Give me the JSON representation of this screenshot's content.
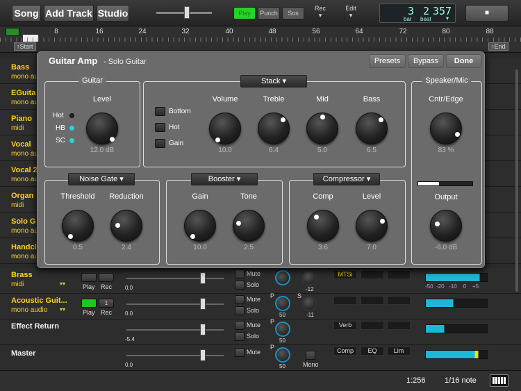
{
  "toolbar": {
    "song": "Song",
    "add_track": "Add Track",
    "studio": "Studio",
    "play": "Play",
    "punch": "Punch",
    "sos": "Sos",
    "rec": "Rec",
    "edit": "Edit",
    "counter": {
      "bar": "3",
      "beat": "2",
      "tick": "357",
      "bar_label": "bar",
      "beat_label": "beat"
    }
  },
  "ruler": {
    "numbers": [
      "8",
      "16",
      "24",
      "32",
      "40",
      "48",
      "56",
      "64",
      "72",
      "80",
      "88"
    ],
    "start": "Start",
    "end": "End"
  },
  "tracks": [
    {
      "name": "Bass",
      "type": "mono au"
    },
    {
      "name": "EGuita",
      "type": "mono au"
    },
    {
      "name": "Piano",
      "type": "midi"
    },
    {
      "name": "Vocal",
      "type": "mono au"
    },
    {
      "name": "Vocal 2",
      "type": "mono au"
    },
    {
      "name": "Organ",
      "type": "midi"
    },
    {
      "name": "Solo G",
      "type": "mono au"
    },
    {
      "name": "Handcl",
      "type": "mono au"
    },
    {
      "name": "Brass",
      "type": "midi"
    },
    {
      "name": "Acoustic Guit...",
      "type": "mono audio"
    },
    {
      "name": "Effect Return",
      "type": ""
    },
    {
      "name": "Master",
      "type": ""
    }
  ],
  "mixer": {
    "play": "Play",
    "rec": "Rec",
    "mute": "Mute",
    "solo": "Solo",
    "mono": "Mono",
    "pan": "P",
    "send": "S",
    "vol_zero": "0.0",
    "vol_fx": "-5.4",
    "pan_val": "50",
    "send_brass": "-12",
    "send_acoustic": "-11",
    "prog": "1",
    "fx_brass": "MTSi",
    "fx_return": "Verb",
    "fx_master": [
      "Comp",
      "EQ",
      "Lim"
    ],
    "meter_scale": [
      "-50",
      "-20",
      "-10",
      "0",
      "+5"
    ]
  },
  "amp": {
    "title": "Guitar Amp",
    "subtitle": "- Solo Guitar",
    "presets": "Presets",
    "bypass": "Bypass",
    "done": "Done",
    "guitar": {
      "title": "Guitar",
      "level_label": "Level",
      "level_value": "12.0 dB",
      "options": [
        "Hot",
        "HB",
        "SC"
      ],
      "active": [
        false,
        true,
        true
      ]
    },
    "stack": {
      "title": "Stack",
      "checks": [
        "Bottom",
        "Hot",
        "Gain"
      ],
      "knobs": [
        {
          "label": "Volume",
          "value": "10.0"
        },
        {
          "label": "Treble",
          "value": "6.4"
        },
        {
          "label": "Mid",
          "value": "5.0"
        },
        {
          "label": "Bass",
          "value": "6.5"
        }
      ]
    },
    "speaker": {
      "title": "Speaker/Mic",
      "cntr_label": "Cntr/Edge",
      "cntr_value": "83 %",
      "output_label": "Output",
      "output_value": "-6.0 dB",
      "level_fraction": 0.38
    },
    "gate": {
      "title": "Noise Gate",
      "knobs": [
        {
          "label": "Threshold",
          "value": "0.5"
        },
        {
          "label": "Reduction",
          "value": "2.4"
        }
      ]
    },
    "booster": {
      "title": "Booster",
      "knobs": [
        {
          "label": "Gain",
          "value": "10.0"
        },
        {
          "label": "Tone",
          "value": "2.5"
        }
      ]
    },
    "compressor": {
      "title": "Compressor",
      "knobs": [
        {
          "label": "Comp",
          "value": "3.6"
        },
        {
          "label": "Level",
          "value": "7.0"
        }
      ]
    }
  },
  "status": {
    "position": "1:256",
    "snap": "1/16 note"
  },
  "colors": {
    "track_name": "#ffd21a",
    "led": "#20d9e0",
    "play_green": "#22c422",
    "meter": "#1fb7d6"
  }
}
